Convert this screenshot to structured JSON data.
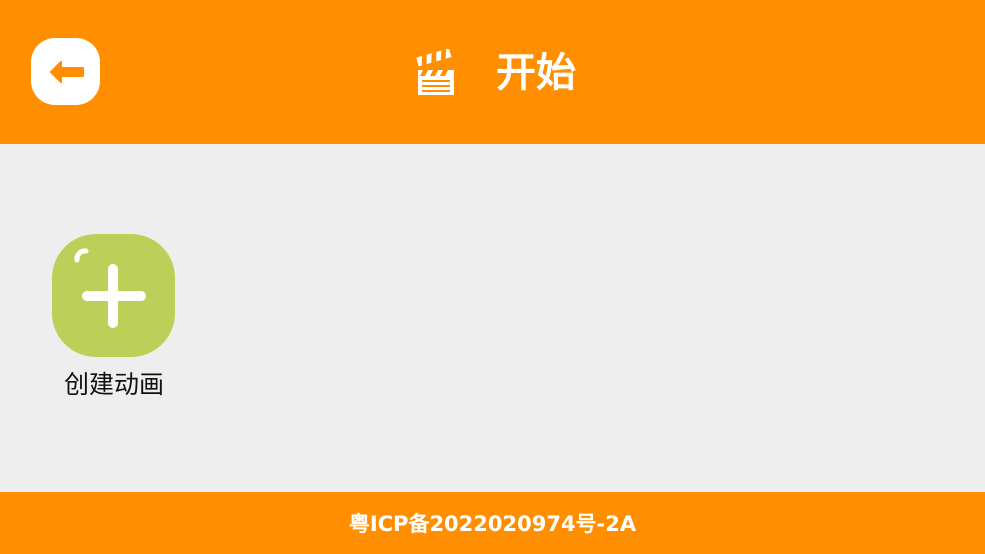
{
  "colors": {
    "header_bg": "#ff8f00",
    "content_bg": "#eeeeee",
    "create_tile": "#bccf58",
    "text_light": "#ffffff",
    "text_dark": "#111111"
  },
  "header": {
    "title": "开始",
    "back_icon": "arrow-left-icon",
    "title_icon": "clapperboard-icon"
  },
  "main": {
    "create_item": {
      "label": "创建动画",
      "icon": "plus-icon"
    }
  },
  "footer": {
    "text": "粤ICP备2022020974号-2A"
  }
}
